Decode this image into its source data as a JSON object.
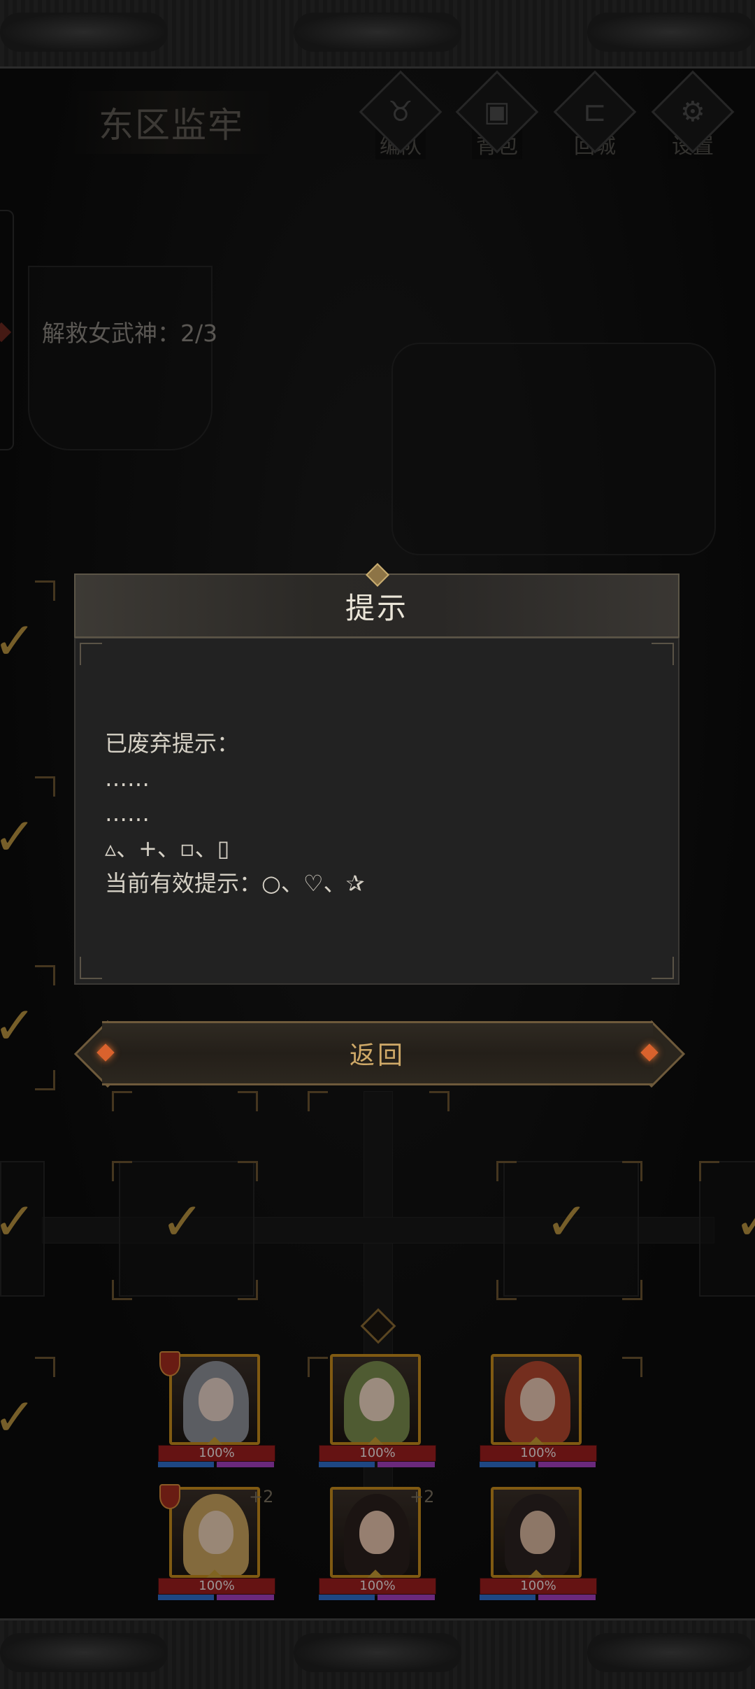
{
  "header": {
    "zone_title": "东区监牢",
    "menu": [
      {
        "label": "编队",
        "icon": "bull-skull-icon"
      },
      {
        "label": "背包",
        "icon": "bag-icon"
      },
      {
        "label": "回城",
        "icon": "exit-door-icon"
      },
      {
        "label": "设置",
        "icon": "gear-icon"
      }
    ]
  },
  "progress": {
    "rescue_label": "解救女武神：2/3",
    "rescued": 2,
    "total": 3
  },
  "dialog": {
    "title": "提示",
    "lines": [
      "已废弃提示：",
      "……",
      "……",
      "▵、+、▫、▯",
      "当前有效提示：○、♡、✰"
    ],
    "return_label": "返回"
  },
  "party": [
    {
      "hp_text": "100%",
      "hp": 1.0,
      "has_badge": true,
      "plus": ""
    },
    {
      "hp_text": "100%",
      "hp": 1.0,
      "has_badge": false,
      "plus": ""
    },
    {
      "hp_text": "100%",
      "hp": 1.0,
      "has_badge": false,
      "plus": ""
    },
    {
      "hp_text": "100%",
      "hp": 1.0,
      "has_badge": true,
      "plus": "+2"
    },
    {
      "hp_text": "100%",
      "hp": 1.0,
      "has_badge": false,
      "plus": "+2"
    },
    {
      "hp_text": "100%",
      "hp": 1.0,
      "has_badge": false,
      "plus": ""
    }
  ],
  "colors": {
    "accent_gold": "#c58a1c",
    "hp_red": "#9b1e1e",
    "mp_blue": "#2f6dc9",
    "sp_purple": "#a33fbf"
  }
}
